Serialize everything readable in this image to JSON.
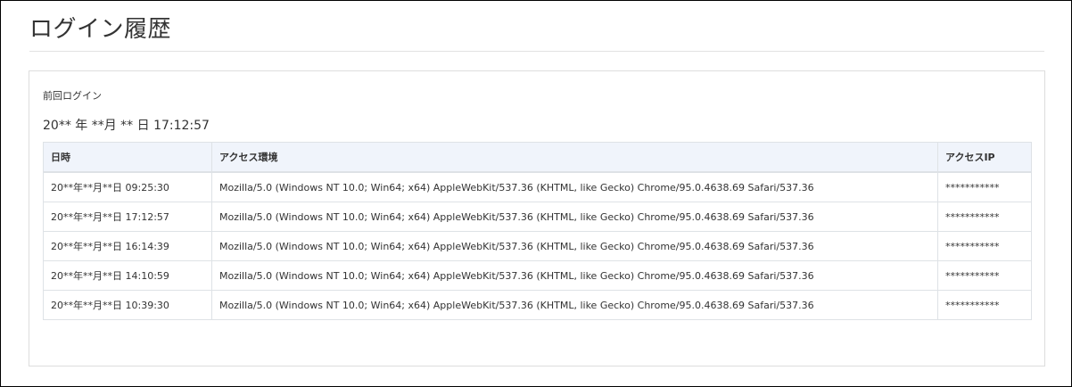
{
  "page": {
    "title": "ログイン履歴"
  },
  "last_login": {
    "label": "前回ログイン",
    "value": "20** 年 **月 ** 日 17:12:57"
  },
  "table": {
    "headers": {
      "datetime": "日時",
      "environment": "アクセス環境",
      "ip": "アクセスIP"
    },
    "rows": [
      {
        "datetime": "20**年**月**日 09:25:30",
        "environment": "Mozilla/5.0 (Windows NT 10.0; Win64; x64) AppleWebKit/537.36 (KHTML, like Gecko) Chrome/95.0.4638.69 Safari/537.36",
        "ip": "***********"
      },
      {
        "datetime": "20**年**月**日 17:12:57",
        "environment": "Mozilla/5.0 (Windows NT 10.0; Win64; x64) AppleWebKit/537.36 (KHTML, like Gecko) Chrome/95.0.4638.69 Safari/537.36",
        "ip": "***********"
      },
      {
        "datetime": "20**年**月**日 16:14:39",
        "environment": "Mozilla/5.0 (Windows NT 10.0; Win64; x64) AppleWebKit/537.36 (KHTML, like Gecko) Chrome/95.0.4638.69 Safari/537.36",
        "ip": "***********"
      },
      {
        "datetime": "20**年**月**日 14:10:59",
        "environment": "Mozilla/5.0 (Windows NT 10.0; Win64; x64) AppleWebKit/537.36 (KHTML, like Gecko) Chrome/95.0.4638.69 Safari/537.36",
        "ip": "***********"
      },
      {
        "datetime": "20**年**月**日 10:39:30",
        "environment": "Mozilla/5.0 (Windows NT 10.0; Win64; x64) AppleWebKit/537.36 (KHTML, like Gecko) Chrome/95.0.4638.69 Safari/537.36",
        "ip": "***********"
      }
    ]
  }
}
